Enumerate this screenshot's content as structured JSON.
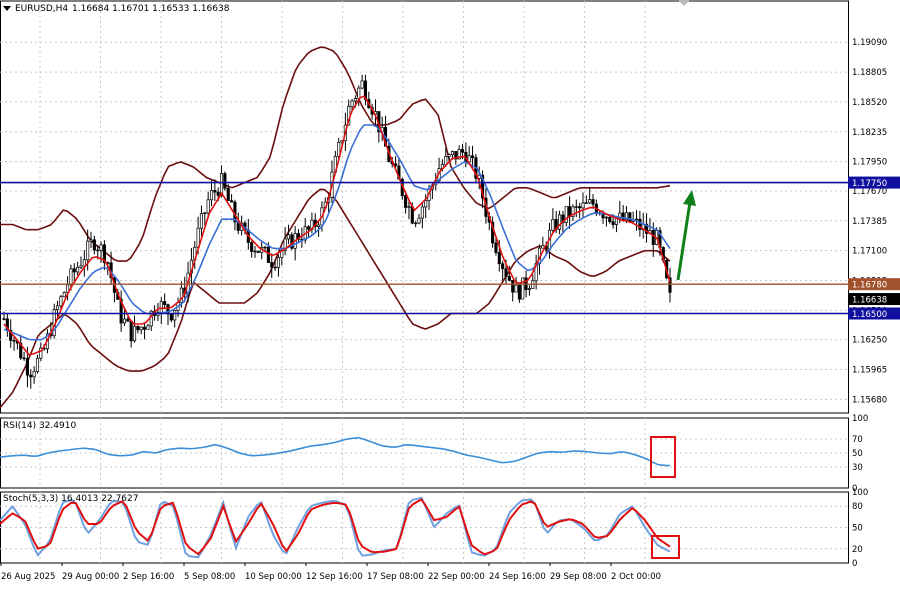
{
  "header": {
    "symbol": "EURUSD,H4",
    "ohlc": "1.16684 1.16701 1.16533 1.16638"
  },
  "colors": {
    "background": "#ffffff",
    "grid": "#c8c8c8",
    "candle": "#000000",
    "bollinger": "#6b0f0f",
    "ma_fast": "#e01010",
    "ma_slow": "#3a6fd8",
    "level_blue": "#1010a0",
    "level_brown": "#a0522d",
    "rsi_line": "#3a8fd8",
    "stoch_main": "#6fa0e0",
    "stoch_signal": "#e01010",
    "arrow": "#10801a",
    "highlight_box": "#e01010"
  },
  "chart_data": [
    {
      "type": "line",
      "name": "main-price",
      "y_ticks": [
        "1.19090",
        "1.18805",
        "1.18520",
        "1.18235",
        "1.17950",
        "1.17670",
        "1.17385",
        "1.17100",
        "1.16815",
        "1.16530",
        "1.16250",
        "1.15965",
        "1.15680"
      ],
      "x_labels": [
        "26 Aug 2025",
        "29 Aug 00:00",
        "2 Sep 16:00",
        "5 Sep 08:00",
        "10 Sep 00:00",
        "12 Sep 16:00",
        "17 Sep 08:00",
        "22 Sep 00:00",
        "24 Sep 16:00",
        "29 Sep 08:00",
        "2 Oct 00:00"
      ],
      "ylim": [
        1.1555,
        1.1935
      ],
      "price_path": [
        1.1645,
        1.162,
        1.1595,
        1.161,
        1.165,
        1.168,
        1.17,
        1.172,
        1.1705,
        1.165,
        1.163,
        1.164,
        1.166,
        1.165,
        1.167,
        1.172,
        1.176,
        1.1775,
        1.174,
        1.172,
        1.171,
        1.17,
        1.1715,
        1.1725,
        1.173,
        1.175,
        1.18,
        1.185,
        1.187,
        1.184,
        1.18,
        1.177,
        1.174,
        1.176,
        1.179,
        1.18,
        1.1805,
        1.178,
        1.173,
        1.1695,
        1.167,
        1.168,
        1.171,
        1.1735,
        1.1745,
        1.175,
        1.1755,
        1.1745,
        1.174,
        1.1738,
        1.173,
        1.172,
        1.1664
      ],
      "bollinger_upper": [
        1.1735,
        1.1735,
        1.173,
        1.173,
        1.1735,
        1.175,
        1.174,
        1.172,
        1.171,
        1.17,
        1.17,
        1.172,
        1.176,
        1.179,
        1.1795,
        1.179,
        1.178,
        1.1775,
        1.177,
        1.1775,
        1.178,
        1.18,
        1.185,
        1.1885,
        1.19,
        1.1905,
        1.19,
        1.188,
        1.185,
        1.183,
        1.183,
        1.1835,
        1.185,
        1.1855,
        1.184,
        1.179,
        1.177,
        1.1755,
        1.175,
        1.176,
        1.177,
        1.177,
        1.1765,
        1.176,
        1.1765,
        1.177,
        1.177,
        1.177,
        1.177,
        1.177,
        1.177,
        1.177,
        1.1772
      ],
      "bollinger_lower": [
        1.156,
        1.1575,
        1.16,
        1.163,
        1.164,
        1.165,
        1.164,
        1.162,
        1.161,
        1.16,
        1.1595,
        1.1595,
        1.16,
        1.161,
        1.164,
        1.168,
        1.167,
        1.166,
        1.166,
        1.166,
        1.167,
        1.169,
        1.172,
        1.174,
        1.176,
        1.177,
        1.176,
        1.174,
        1.172,
        1.17,
        1.168,
        1.166,
        1.164,
        1.1635,
        1.164,
        1.165,
        1.165,
        1.165,
        1.166,
        1.168,
        1.17,
        1.171,
        1.1715,
        1.1705,
        1.17,
        1.169,
        1.1685,
        1.169,
        1.17,
        1.1705,
        1.171,
        1.171,
        1.17
      ],
      "ma_fast": [
        1.164,
        1.1625,
        1.161,
        1.1615,
        1.164,
        1.167,
        1.169,
        1.1705,
        1.17,
        1.1665,
        1.164,
        1.164,
        1.1655,
        1.1655,
        1.1665,
        1.1705,
        1.1745,
        1.1765,
        1.1745,
        1.1725,
        1.1712,
        1.1705,
        1.1712,
        1.1722,
        1.173,
        1.1745,
        1.179,
        1.184,
        1.186,
        1.184,
        1.1805,
        1.1775,
        1.1748,
        1.176,
        1.1785,
        1.1798,
        1.18,
        1.178,
        1.1738,
        1.1702,
        1.1678,
        1.1682,
        1.1708,
        1.173,
        1.1742,
        1.1748,
        1.1752,
        1.1745,
        1.174,
        1.1737,
        1.173,
        1.1722,
        1.168
      ],
      "ma_slow": [
        1.1635,
        1.163,
        1.1625,
        1.1625,
        1.1635,
        1.1655,
        1.1675,
        1.169,
        1.1695,
        1.168,
        1.166,
        1.165,
        1.165,
        1.1652,
        1.166,
        1.1685,
        1.1715,
        1.174,
        1.174,
        1.173,
        1.172,
        1.1712,
        1.1712,
        1.1718,
        1.1724,
        1.1735,
        1.1765,
        1.1805,
        1.183,
        1.183,
        1.1815,
        1.1795,
        1.1772,
        1.1768,
        1.1778,
        1.1788,
        1.1795,
        1.1788,
        1.1762,
        1.173,
        1.17,
        1.169,
        1.17,
        1.1718,
        1.1732,
        1.174,
        1.1746,
        1.1745,
        1.1742,
        1.174,
        1.1735,
        1.173,
        1.1712
      ],
      "levels": [
        {
          "label": "1.17750",
          "value": 1.1775,
          "role": "blue"
        },
        {
          "label": "1.16780",
          "value": 1.1678,
          "role": "brown"
        },
        {
          "label": "1.16500",
          "value": 1.165,
          "role": "blue"
        }
      ],
      "current_price_label": "1.16638",
      "current_price": 1.16638,
      "grid": true
    },
    {
      "type": "line",
      "name": "RSI(14)",
      "label": "RSI(14) 32.4910",
      "ylim": [
        0,
        100
      ],
      "y_ticks": [
        "100",
        "70",
        "50",
        "30",
        "0"
      ],
      "values": [
        44,
        46,
        47,
        45,
        50,
        53,
        55,
        57,
        55,
        48,
        46,
        47,
        52,
        50,
        55,
        57,
        56,
        58,
        62,
        57,
        50,
        46,
        47,
        49,
        52,
        56,
        60,
        62,
        65,
        70,
        72,
        66,
        60,
        58,
        62,
        60,
        58,
        56,
        52,
        47,
        44,
        40,
        36,
        38,
        44,
        50,
        52,
        51,
        53,
        52,
        50,
        49,
        52,
        48,
        42,
        33,
        32
      ]
    },
    {
      "type": "line",
      "name": "Stoch(5,3,3)",
      "label": "Stoch(5,3,3) 16.4013 22.7627",
      "ylim": [
        0,
        100
      ],
      "y_ticks": [
        "100",
        "80",
        "50",
        "20",
        "0"
      ],
      "main": [
        60,
        80,
        55,
        10,
        30,
        85,
        90,
        40,
        60,
        88,
        85,
        30,
        25,
        88,
        80,
        10,
        8,
        40,
        85,
        20,
        65,
        88,
        40,
        10,
        50,
        80,
        85,
        88,
        80,
        10,
        12,
        18,
        20,
        88,
        92,
        50,
        70,
        82,
        15,
        10,
        20,
        70,
        88,
        90,
        40,
        60,
        62,
        50,
        30,
        40,
        70,
        80,
        50,
        25,
        16
      ],
      "signal": [
        55,
        70,
        60,
        20,
        25,
        75,
        88,
        55,
        55,
        80,
        88,
        45,
        30,
        80,
        85,
        25,
        12,
        35,
        80,
        30,
        55,
        85,
        55,
        15,
        40,
        75,
        82,
        85,
        82,
        25,
        15,
        16,
        20,
        80,
        90,
        60,
        65,
        80,
        25,
        12,
        18,
        60,
        82,
        88,
        50,
        58,
        62,
        55,
        35,
        38,
        62,
        78,
        60,
        35,
        23
      ]
    }
  ]
}
